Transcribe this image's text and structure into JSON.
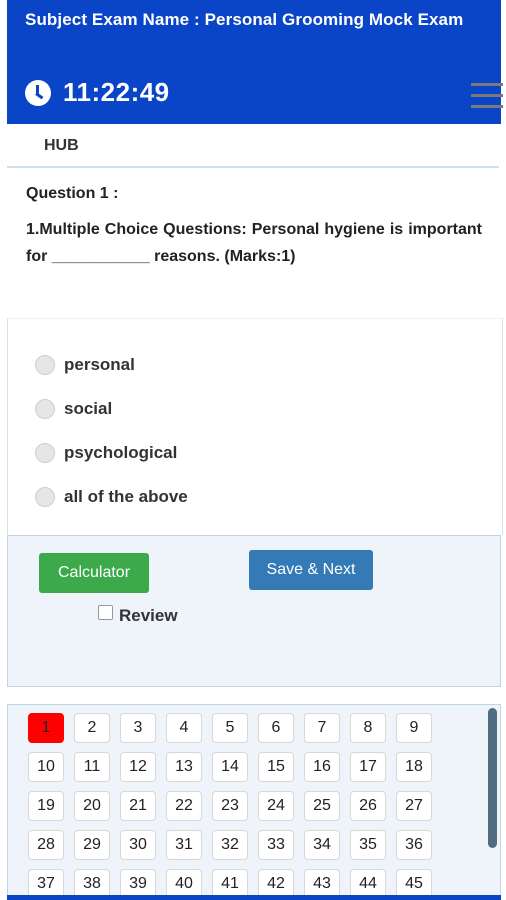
{
  "header": {
    "exam_title": "Subject Exam Name : Personal Grooming Mock Exam",
    "timer": "11:22:49",
    "clock_icon": "clock-icon",
    "menu_icon": "hamburger-menu-icon",
    "background_color": "#0a45c8"
  },
  "section": {
    "label": "HUB"
  },
  "question": {
    "number_label": "Question 1 :",
    "text": "1.Multiple Choice Questions: Personal hygiene is important for ___________ reasons. (Marks:1)"
  },
  "options": [
    {
      "label": "personal"
    },
    {
      "label": "social"
    },
    {
      "label": "psychological"
    },
    {
      "label": "all of the above"
    }
  ],
  "actions": {
    "calculator_label": "Calculator",
    "calculator_color": "#3caa4b",
    "save_next_label": "Save & Next",
    "save_next_color": "#337ab7",
    "review_label": "Review"
  },
  "palette": {
    "current_question": "1",
    "current_color": "#ff0000",
    "numbers": [
      "1",
      "2",
      "3",
      "4",
      "5",
      "6",
      "7",
      "8",
      "9",
      "10",
      "11",
      "12",
      "13",
      "14",
      "15",
      "16",
      "17",
      "18",
      "19",
      "20",
      "21",
      "22",
      "23",
      "24",
      "25",
      "26",
      "27",
      "28",
      "29",
      "30",
      "31",
      "32",
      "33",
      "34",
      "35",
      "36",
      "37",
      "38",
      "39",
      "40",
      "41",
      "42",
      "43",
      "44",
      "45"
    ]
  }
}
